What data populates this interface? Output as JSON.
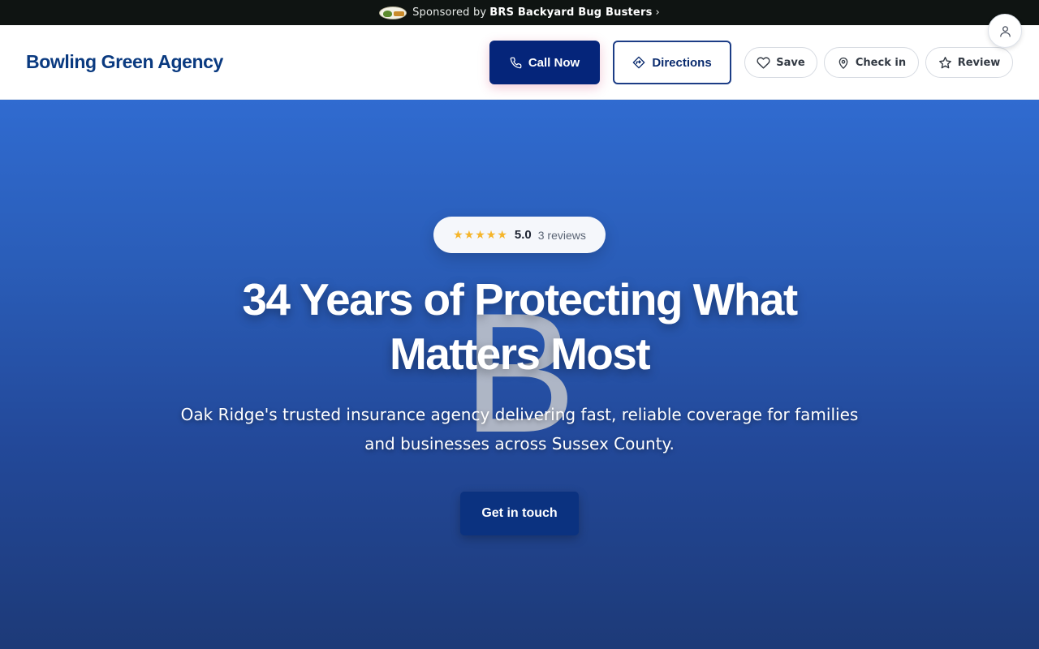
{
  "sponsor": {
    "prefix": "Sponsored by",
    "brand": "BRS Backyard Bug Busters",
    "chevron": "›",
    "logo_icon": "sponsor-logo-icon"
  },
  "header": {
    "brand": "Bowling Green Agency",
    "call_label": "Call Now",
    "directions_label": "Directions",
    "save_label": "Save",
    "checkin_label": "Check in",
    "review_label": "Review"
  },
  "hero": {
    "stars": "★★★★★",
    "rating_value": 5.0,
    "rating_score": "5.0",
    "reviews_label": "3 reviews",
    "watermark": "B",
    "headline": "34 Years of Protecting What Matters Most",
    "subline": "Oak Ridge's trusted insurance agency delivering fast, reliable coverage for families and businesses across Sussex County.",
    "cta_label": "Get in touch"
  },
  "colors": {
    "sponsor_bg": "#0f1412",
    "brand_text": "#0a3a80",
    "call_bg": "#05257a",
    "hero_top": "#306bd0",
    "hero_bottom": "#1d3a78",
    "star": "#f5b52a",
    "cta_bg": "#0b3280"
  }
}
